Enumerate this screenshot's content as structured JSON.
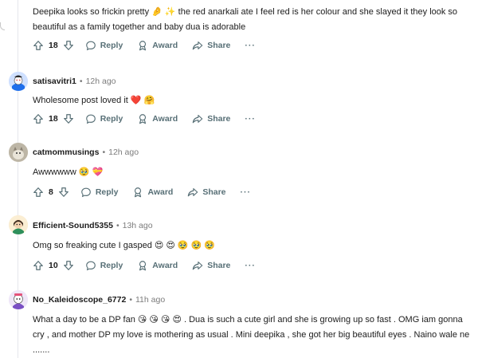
{
  "comments": [
    {
      "username": "",
      "age": "",
      "body": "Deepika looks so frickin pretty 🤌 ✨ the red anarkali ate I feel red is her colour and she slayed it they look so beautiful as a family together and baby dua is adorable",
      "votes": "18",
      "reply_label": "Reply",
      "award_label": "Award",
      "share_label": "Share",
      "more_label": "···"
    },
    {
      "username": "satisavitri1",
      "age": "12h ago",
      "body": "Wholesome post loved it ❤️ 🤗",
      "votes": "18",
      "reply_label": "Reply",
      "award_label": "Award",
      "share_label": "Share",
      "more_label": "···"
    },
    {
      "username": "catmommusings",
      "age": "12h ago",
      "body": "Awwwwww 🥹 💝",
      "votes": "8",
      "reply_label": "Reply",
      "award_label": "Award",
      "share_label": "Share",
      "more_label": "···"
    },
    {
      "username": "Efficient-Sound5355",
      "age": "13h ago",
      "body": "Omg so freaking cute I gasped 😍 😍 🥹 🥹 🥹",
      "votes": "10",
      "reply_label": "Reply",
      "award_label": "Award",
      "share_label": "Share",
      "more_label": "···"
    },
    {
      "username": "No_Kaleidoscope_6772",
      "age": "11h ago",
      "body": "What a day to be a DP fan 😘 😘 😘 😍 . Dua is such a cute girl and she is growing up so fast . OMG iam gonna cry , and mother DP my love is mothering as usual . Mini deepika , she got her big beautiful eyes . Naino wale ne .......",
      "votes": "",
      "reply_label": "",
      "award_label": "",
      "share_label": "",
      "more_label": ""
    }
  ],
  "separator": "•",
  "icons": {
    "upvote": "upvote-arrow-icon",
    "downvote": "downvote-arrow-icon",
    "reply": "reply-bubble-icon",
    "award": "award-ribbon-icon",
    "share": "share-arrow-icon"
  },
  "colors": {
    "text": "#1c1c1c",
    "meta": "#7c7c7c",
    "action": "#576f76",
    "thread_line": "#e5e7eb"
  }
}
